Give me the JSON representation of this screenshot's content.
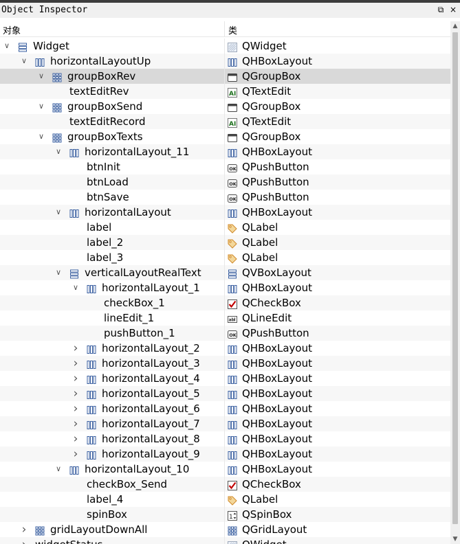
{
  "window": {
    "title": "Object Inspector",
    "float_glyph": "⧉",
    "close_glyph": "×"
  },
  "header": {
    "object_col": "对象",
    "class_col": "类"
  },
  "colors": {
    "layout_icon": "#3a5fa0",
    "selected_row": "#d9d9d9",
    "alt_row": "#f7f7f7",
    "checkbox_red": "#c00000",
    "label_tag": "#d08a2a"
  },
  "tree": {
    "rows": [
      {
        "name": "Widget",
        "cls": "QWidget",
        "depth": 0,
        "arrow": "expanded",
        "icon": "vbox-layout-icon",
        "cls_icon": "widget-icon"
      },
      {
        "name": "horizontalLayoutUp",
        "cls": "QHBoxLayout",
        "depth": 1,
        "arrow": "expanded",
        "icon": "hbox-layout-icon",
        "cls_icon": "hbox-layout-icon"
      },
      {
        "name": "groupBoxRev",
        "cls": "QGroupBox",
        "depth": 2,
        "arrow": "expanded",
        "icon": "grid-layout-icon",
        "cls_icon": "groupbox-icon",
        "selected": true
      },
      {
        "name": "textEditRev",
        "cls": "QTextEdit",
        "depth": 3,
        "arrow": "none",
        "icon": "",
        "cls_icon": "textedit-icon"
      },
      {
        "name": "groupBoxSend",
        "cls": "QGroupBox",
        "depth": 2,
        "arrow": "expanded",
        "icon": "grid-layout-icon",
        "cls_icon": "groupbox-icon"
      },
      {
        "name": "textEditRecord",
        "cls": "QTextEdit",
        "depth": 3,
        "arrow": "none",
        "icon": "",
        "cls_icon": "textedit-icon"
      },
      {
        "name": "groupBoxTexts",
        "cls": "QGroupBox",
        "depth": 2,
        "arrow": "expanded",
        "icon": "grid-layout-icon",
        "cls_icon": "groupbox-icon"
      },
      {
        "name": "horizontalLayout_11",
        "cls": "QHBoxLayout",
        "depth": 3,
        "arrow": "expanded",
        "icon": "hbox-layout-icon",
        "cls_icon": "hbox-layout-icon"
      },
      {
        "name": "btnInit",
        "cls": "QPushButton",
        "depth": 4,
        "arrow": "none",
        "icon": "",
        "cls_icon": "pushbutton-icon"
      },
      {
        "name": "btnLoad",
        "cls": "QPushButton",
        "depth": 4,
        "arrow": "none",
        "icon": "",
        "cls_icon": "pushbutton-icon"
      },
      {
        "name": "btnSave",
        "cls": "QPushButton",
        "depth": 4,
        "arrow": "none",
        "icon": "",
        "cls_icon": "pushbutton-icon"
      },
      {
        "name": "horizontalLayout",
        "cls": "QHBoxLayout",
        "depth": 3,
        "arrow": "expanded",
        "icon": "hbox-layout-icon",
        "cls_icon": "hbox-layout-icon"
      },
      {
        "name": "label",
        "cls": "QLabel",
        "depth": 4,
        "arrow": "none",
        "icon": "",
        "cls_icon": "label-icon"
      },
      {
        "name": "label_2",
        "cls": "QLabel",
        "depth": 4,
        "arrow": "none",
        "icon": "",
        "cls_icon": "label-icon"
      },
      {
        "name": "label_3",
        "cls": "QLabel",
        "depth": 4,
        "arrow": "none",
        "icon": "",
        "cls_icon": "label-icon"
      },
      {
        "name": "verticalLayoutRealText",
        "cls": "QVBoxLayout",
        "depth": 3,
        "arrow": "expanded",
        "icon": "vbox-layout-icon",
        "cls_icon": "vbox-layout-icon"
      },
      {
        "name": "horizontalLayout_1",
        "cls": "QHBoxLayout",
        "depth": 4,
        "arrow": "expanded",
        "icon": "hbox-layout-icon",
        "cls_icon": "hbox-layout-icon"
      },
      {
        "name": "checkBox_1",
        "cls": "QCheckBox",
        "depth": 5,
        "arrow": "none",
        "icon": "",
        "cls_icon": "checkbox-icon"
      },
      {
        "name": "lineEdit_1",
        "cls": "QLineEdit",
        "depth": 5,
        "arrow": "none",
        "icon": "",
        "cls_icon": "lineedit-icon"
      },
      {
        "name": "pushButton_1",
        "cls": "QPushButton",
        "depth": 5,
        "arrow": "none",
        "icon": "",
        "cls_icon": "pushbutton-icon"
      },
      {
        "name": "horizontalLayout_2",
        "cls": "QHBoxLayout",
        "depth": 4,
        "arrow": "collapsed",
        "icon": "hbox-layout-icon",
        "cls_icon": "hbox-layout-icon"
      },
      {
        "name": "horizontalLayout_3",
        "cls": "QHBoxLayout",
        "depth": 4,
        "arrow": "collapsed",
        "icon": "hbox-layout-icon",
        "cls_icon": "hbox-layout-icon"
      },
      {
        "name": "horizontalLayout_4",
        "cls": "QHBoxLayout",
        "depth": 4,
        "arrow": "collapsed",
        "icon": "hbox-layout-icon",
        "cls_icon": "hbox-layout-icon"
      },
      {
        "name": "horizontalLayout_5",
        "cls": "QHBoxLayout",
        "depth": 4,
        "arrow": "collapsed",
        "icon": "hbox-layout-icon",
        "cls_icon": "hbox-layout-icon"
      },
      {
        "name": "horizontalLayout_6",
        "cls": "QHBoxLayout",
        "depth": 4,
        "arrow": "collapsed",
        "icon": "hbox-layout-icon",
        "cls_icon": "hbox-layout-icon"
      },
      {
        "name": "horizontalLayout_7",
        "cls": "QHBoxLayout",
        "depth": 4,
        "arrow": "collapsed",
        "icon": "hbox-layout-icon",
        "cls_icon": "hbox-layout-icon"
      },
      {
        "name": "horizontalLayout_8",
        "cls": "QHBoxLayout",
        "depth": 4,
        "arrow": "collapsed",
        "icon": "hbox-layout-icon",
        "cls_icon": "hbox-layout-icon"
      },
      {
        "name": "horizontalLayout_9",
        "cls": "QHBoxLayout",
        "depth": 4,
        "arrow": "collapsed",
        "icon": "hbox-layout-icon",
        "cls_icon": "hbox-layout-icon"
      },
      {
        "name": "horizontalLayout_10",
        "cls": "QHBoxLayout",
        "depth": 3,
        "arrow": "expanded",
        "icon": "hbox-layout-icon",
        "cls_icon": "hbox-layout-icon"
      },
      {
        "name": "checkBox_Send",
        "cls": "QCheckBox",
        "depth": 4,
        "arrow": "none",
        "icon": "",
        "cls_icon": "checkbox-icon"
      },
      {
        "name": "label_4",
        "cls": "QLabel",
        "depth": 4,
        "arrow": "none",
        "icon": "",
        "cls_icon": "label-icon"
      },
      {
        "name": "spinBox",
        "cls": "QSpinBox",
        "depth": 4,
        "arrow": "none",
        "icon": "",
        "cls_icon": "spinbox-icon"
      },
      {
        "name": "gridLayoutDownAll",
        "cls": "QGridLayout",
        "depth": 1,
        "arrow": "collapsed",
        "icon": "grid-layout-icon",
        "cls_icon": "grid-layout-icon"
      },
      {
        "name": "widgetStatus",
        "cls": "QWidget",
        "depth": 1,
        "arrow": "collapsed",
        "icon": "",
        "cls_icon": "widget-icon"
      }
    ]
  }
}
